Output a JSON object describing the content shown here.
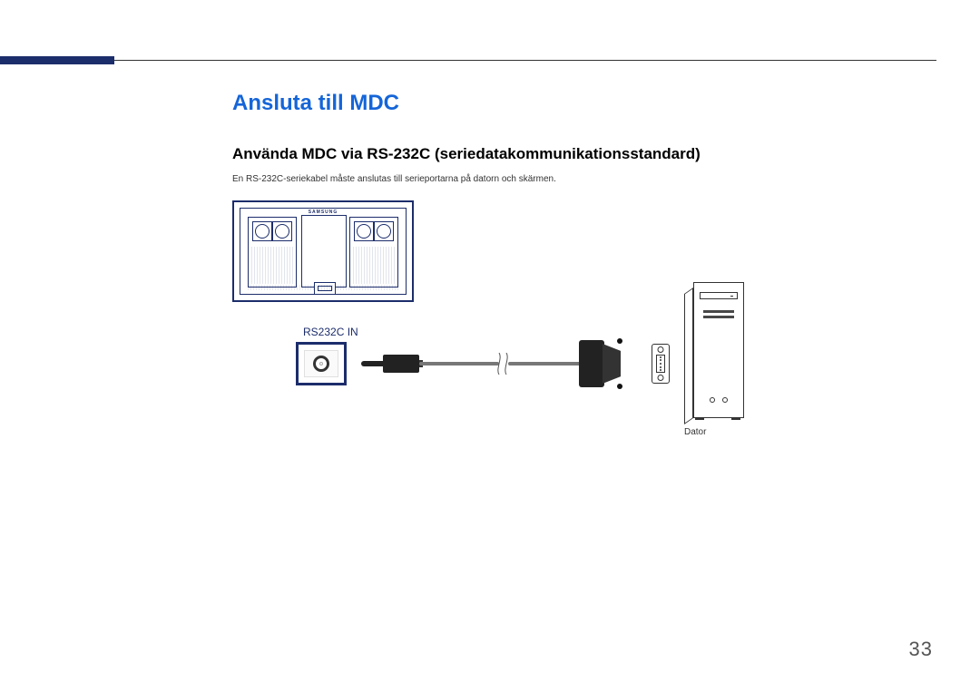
{
  "header": {},
  "content": {
    "title": "Ansluta till MDC",
    "subtitle": "Använda MDC via RS-232C (seriedatakommunikationsstandard)",
    "body": "En RS-232C-seriekabel måste anslutas till serieportarna på datorn och skärmen."
  },
  "diagram": {
    "display_brand": "SAMSUNG",
    "port_label": "RS232C IN",
    "pc_label": "Dator"
  },
  "page_number": "33"
}
